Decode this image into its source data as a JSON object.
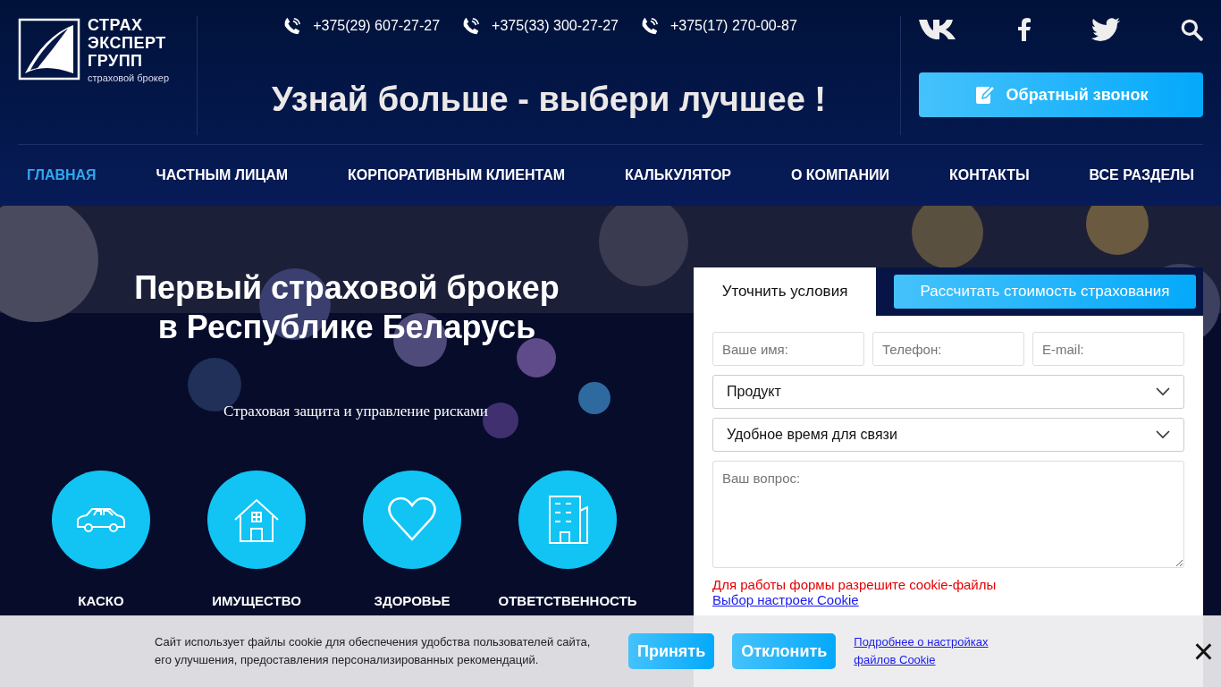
{
  "header": {
    "logo": {
      "lines": [
        "СТРАХ",
        "ЭКСПЕРТ",
        "ГРУПП"
      ],
      "tagline": "страховой брокер"
    },
    "phones": [
      "+375(29) 607-27-27",
      "+375(33) 300-27-27",
      "+375(17) 270-00-87"
    ],
    "slogan": "Узнай больше - выбери лучшее !",
    "callback_button": "Обратный звонок"
  },
  "nav": [
    {
      "label": "ГЛАВНАЯ",
      "selected": true
    },
    {
      "label": "ЧАСТНЫМ ЛИЦАМ",
      "selected": false
    },
    {
      "label": "КОРПОРАТИВНЫМ КЛИЕНТАМ",
      "selected": false
    },
    {
      "label": "КАЛЬКУЛЯТОР",
      "selected": false
    },
    {
      "label": "О КОМПАНИИ",
      "selected": false
    },
    {
      "label": "КОНТАКТЫ",
      "selected": false
    },
    {
      "label": "ВСЕ РАЗДЕЛЫ",
      "selected": false
    }
  ],
  "hero": {
    "title_lines": [
      "Первый страховой брокер",
      "в Республике Беларусь"
    ],
    "subtitle": "Страховая защита и управление рисками",
    "categories": [
      {
        "kind": "car",
        "label": "КАСКО"
      },
      {
        "kind": "house",
        "label": "ИМУЩЕСТВО"
      },
      {
        "kind": "heart",
        "label": "ЗДОРОВЬЕ"
      },
      {
        "kind": "building",
        "label": "ОТВЕТСТВЕННОСТЬ"
      }
    ]
  },
  "form": {
    "tabs": [
      {
        "label": "Уточнить условия",
        "selected": true
      },
      {
        "label": "Рассчитать стоимость страхования",
        "selected": false
      }
    ],
    "fields": [
      {
        "placeholder": "Ваше имя:"
      },
      {
        "placeholder": "Телефон:"
      },
      {
        "placeholder": "E-mail:"
      }
    ],
    "selects": [
      "Продукт",
      "Удобное время для связи"
    ],
    "question": {
      "placeholder": "Ваш вопрос:"
    },
    "cookie_warning": "Для работы формы разрешите cookie-файлы",
    "cookie_settings_link": "Выбор настроек Cookie"
  },
  "cookie_banner": {
    "text": "Сайт использует файлы cookie для обеспечения удобства пользователей сайта, его улучшения, предоставления персонализированных рекомендаций.",
    "accept": "Принять",
    "decline": "Отклонить",
    "more_link": "Подробнее о настройках файлов Cookie",
    "close": "×"
  }
}
